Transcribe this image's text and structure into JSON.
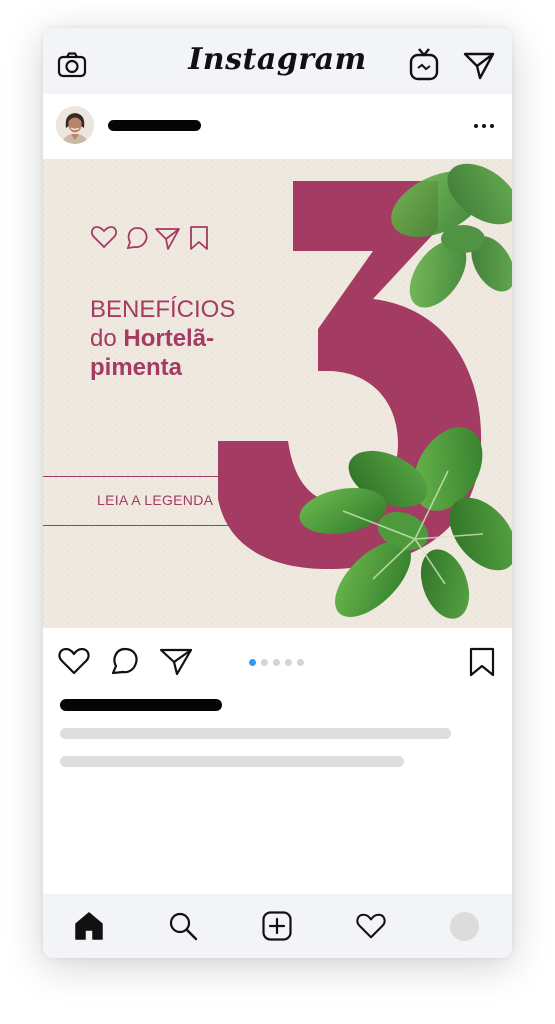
{
  "app": {
    "logo_text": "Instagram"
  },
  "header": {
    "icons": [
      "camera-icon",
      "igtv-icon",
      "direct-send-icon"
    ]
  },
  "post_header": {
    "more_icon": "more-horizontal-icon"
  },
  "post_image": {
    "big_number": "3",
    "headline_line1": "BENEFÍCIOS",
    "headline_line2a": "do ",
    "headline_line2b": "Hortelã-",
    "headline_line3": "pimenta",
    "cta": "LEIA A LEGENDA",
    "mini_icons": [
      "heart-icon",
      "comment-icon",
      "send-icon",
      "bookmark-icon"
    ]
  },
  "actions": {
    "icons": [
      "heart-icon",
      "comment-icon",
      "send-icon",
      "bookmark-icon"
    ],
    "carousel_pages": 5,
    "carousel_active": 1
  },
  "bottom_nav": {
    "icons": [
      "home-icon",
      "search-icon",
      "add-post-icon",
      "heart-icon",
      "profile-avatar"
    ]
  },
  "colors": {
    "accent": "#a33b63",
    "mint": "#4f9a3a",
    "carousel_active": "#3897f0",
    "paper": "#efe9df"
  }
}
